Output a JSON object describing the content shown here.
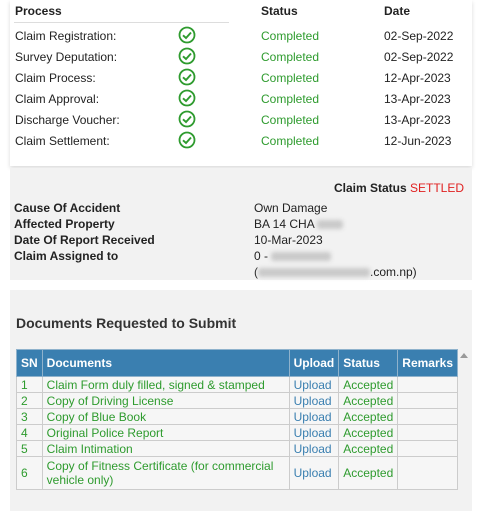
{
  "process": {
    "headers": {
      "process": "Process",
      "status": "Status",
      "date": "Date"
    },
    "rows": [
      {
        "name": "Claim Registration:",
        "status": "Completed",
        "date": "02-Sep-2022"
      },
      {
        "name": "Survey Deputation:",
        "status": "Completed",
        "date": "02-Sep-2022"
      },
      {
        "name": "Claim Process:",
        "status": "Completed",
        "date": "12-Apr-2023"
      },
      {
        "name": "Claim Approval:",
        "status": "Completed",
        "date": "13-Apr-2023"
      },
      {
        "name": "Discharge Voucher:",
        "status": "Completed",
        "date": "13-Apr-2023"
      },
      {
        "name": "Claim Settlement:",
        "status": "Completed",
        "date": "12-Jun-2023"
      }
    ],
    "check_color": "#2e9b2e"
  },
  "claim": {
    "status_label": "Claim Status",
    "status_value": "SETTLED",
    "cause_label": "Cause Of Accident",
    "cause_value": "Own Damage",
    "property_label": "Affected Property",
    "property_value": "BA 14 CHA",
    "report_label": "Date Of Report Received",
    "report_value": "10-Mar-2023",
    "assigned_label": "Claim Assigned to",
    "assigned_prefix": "0 -",
    "email_open": "(",
    "email_suffix": ".com.np)"
  },
  "documents": {
    "title": "Documents Requested to Submit",
    "headers": {
      "sn": "SN",
      "documents": "Documents",
      "upload": "Upload",
      "status": "Status",
      "remarks": "Remarks"
    },
    "rows": [
      {
        "sn": "1",
        "document": "Claim Form duly filled, signed & stamped",
        "upload": "Upload",
        "status": "Accepted",
        "remarks": ""
      },
      {
        "sn": "2",
        "document": "Copy of Driving License",
        "upload": "Upload",
        "status": "Accepted",
        "remarks": ""
      },
      {
        "sn": "3",
        "document": "Copy of Blue Book",
        "upload": "Upload",
        "status": "Accepted",
        "remarks": ""
      },
      {
        "sn": "4",
        "document": "Original Police Report",
        "upload": "Upload",
        "status": "Accepted",
        "remarks": ""
      },
      {
        "sn": "5",
        "document": "Claim Intimation",
        "upload": "Upload",
        "status": "Accepted",
        "remarks": ""
      },
      {
        "sn": "6",
        "document": "Copy of Fitness Certificate (for commercial vehicle only)",
        "upload": "Upload",
        "status": "Accepted",
        "remarks": ""
      }
    ],
    "colors": {
      "header_bg": "#3a7fb0",
      "accepted": "#2e9b2e",
      "link": "#3a7fb0",
      "settled": "#e02020"
    }
  }
}
